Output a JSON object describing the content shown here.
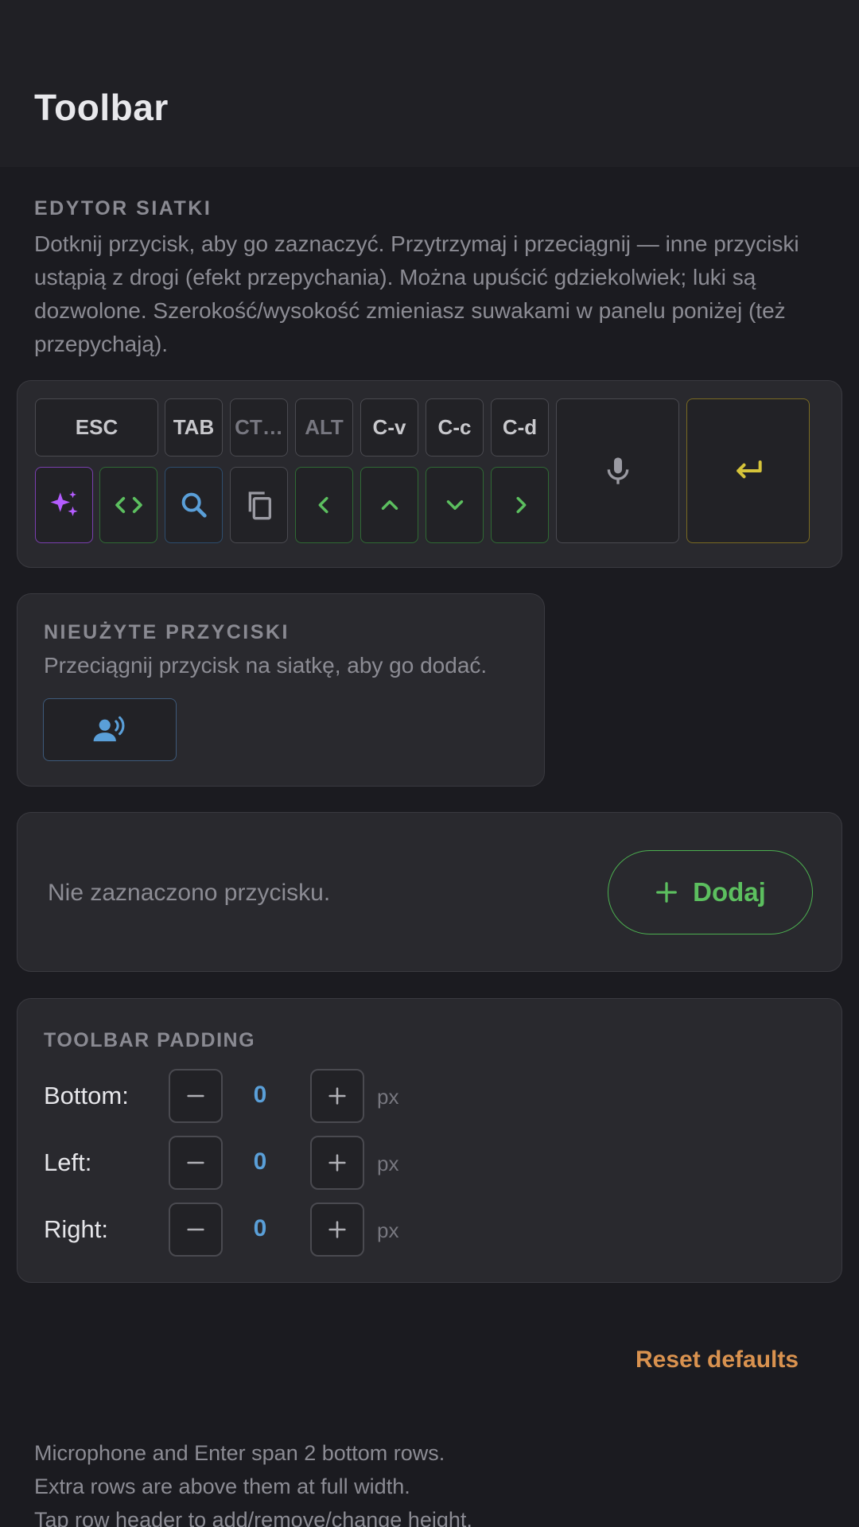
{
  "header": {
    "title": "Toolbar"
  },
  "grid_editor": {
    "label": "EDYTOR SIATKI",
    "description": "Dotknij przycisk, aby go zaznaczyć. Przytrzymaj i przeciągnij — inne przyciski ustąpią z drogi (efekt przepychania). Można upuścić gdziekolwiek; luki są dozwolone. Szerokość/wysokość zmieniasz suwakami w panelu poniżej (też przepychają).",
    "keys": {
      "esc": "ESC",
      "tab": "TAB",
      "ctrl": "CT…",
      "alt": "ALT",
      "cv": "C-v",
      "cc": "C-c",
      "cd": "C-d"
    },
    "icons": [
      "sparkle-icon",
      "code-icon",
      "search-icon",
      "copy-icon",
      "chevron-left-icon",
      "chevron-up-icon",
      "chevron-down-icon",
      "chevron-right-icon",
      "microphone-icon",
      "enter-icon"
    ]
  },
  "unused": {
    "title": "NIEUŻYTE PRZYCISKI",
    "subtitle": "Przeciągnij przycisk na siatkę, aby go dodać.",
    "keys": [
      "voice-user-icon"
    ]
  },
  "selection": {
    "empty_text": "Nie zaznaczono przycisku.",
    "add_label": "Dodaj"
  },
  "padding": {
    "title": "TOOLBAR PADDING",
    "rows": [
      {
        "label": "Bottom:",
        "value": "0",
        "unit": "px"
      },
      {
        "label": "Left:",
        "value": "0",
        "unit": "px"
      },
      {
        "label": "Right:",
        "value": "0",
        "unit": "px"
      }
    ]
  },
  "reset_label": "Reset defaults",
  "footer": {
    "line1": "Microphone and Enter span 2 bottom rows.",
    "line2": "Extra rows are above them at full width.",
    "line3": "Tap row header to add/remove/change height."
  },
  "colors": {
    "background": "#1b1b20",
    "card": "#29292e",
    "green": "#5cbf5f",
    "blue": "#5a9fd8",
    "purple": "#b45cff",
    "yellow": "#d6c43a",
    "orange": "#d9924f"
  }
}
